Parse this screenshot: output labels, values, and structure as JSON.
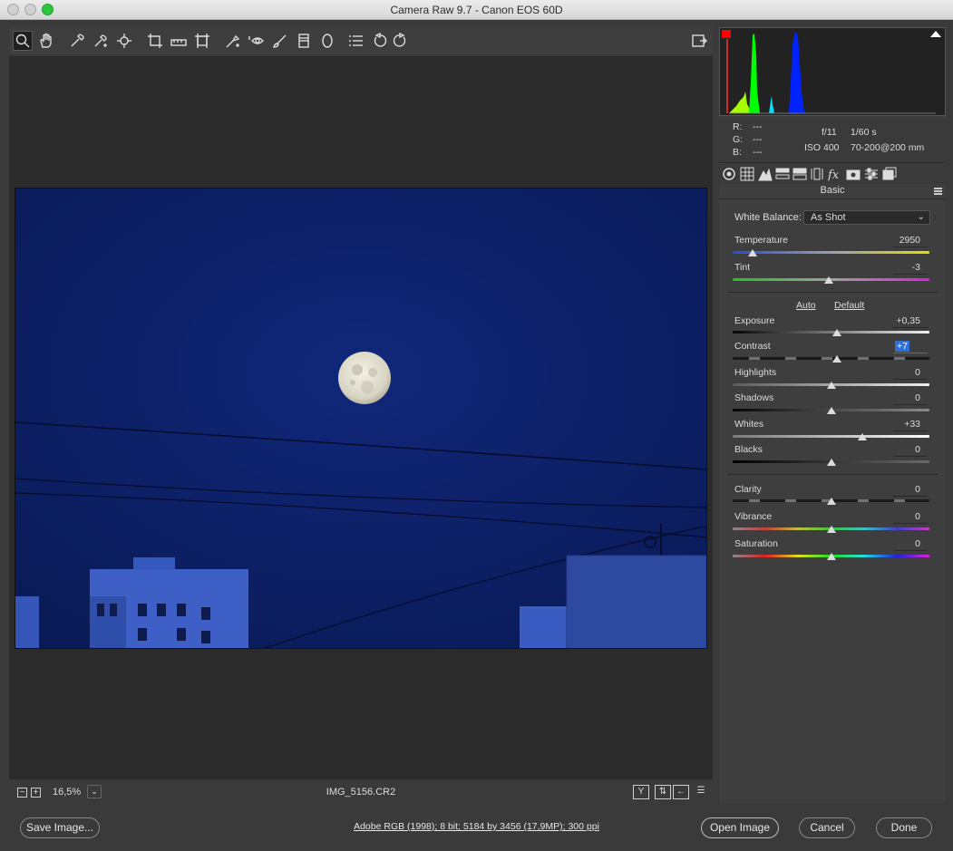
{
  "window": {
    "title": "Camera Raw 9.7  -  Canon EOS 60D"
  },
  "toolbar": {
    "tools": [
      "zoom-icon",
      "hand-icon",
      "white-balance-icon",
      "color-sampler-icon",
      "targeted-adjustment-icon",
      "crop-icon",
      "straighten-icon",
      "transform-icon",
      "spot-removal-icon",
      "red-eye-icon",
      "adjustment-brush-icon",
      "graduated-filter-icon",
      "radial-filter-icon",
      "preferences-icon",
      "rotate-left-icon",
      "rotate-right-icon"
    ],
    "fullscreen_icon": "fullscreen-icon"
  },
  "exif": {
    "r_label": "R:",
    "r_val": "---",
    "g_label": "G:",
    "g_val": "---",
    "b_label": "B:",
    "b_val": "---",
    "aperture": "f/11",
    "shutter": "1/60 s",
    "iso": "ISO 400",
    "lens": "70-200@200 mm"
  },
  "panel": {
    "tabs": [
      "basic-icon",
      "tone-curve-icon",
      "detail-icon",
      "hsl-icon",
      "split-toning-icon",
      "lens-corrections-icon",
      "effects-icon",
      "camera-calibration-icon",
      "presets-icon",
      "snapshots-icon"
    ],
    "title": "Basic",
    "white_balance_label": "White Balance:",
    "white_balance_value": "As Shot",
    "auto_label": "Auto",
    "default_label": "Default",
    "controls": {
      "temperature": {
        "label": "Temperature",
        "value": "2950",
        "position": 0.1
      },
      "tint": {
        "label": "Tint",
        "value": "-3",
        "position": 0.49
      },
      "exposure": {
        "label": "Exposure",
        "value": "+0,35",
        "position": 0.53
      },
      "contrast": {
        "label": "Contrast",
        "value": "+7",
        "position": 0.53
      },
      "highlights": {
        "label": "Highlights",
        "value": "0",
        "position": 0.5
      },
      "shadows": {
        "label": "Shadows",
        "value": "0",
        "position": 0.5
      },
      "whites": {
        "label": "Whites",
        "value": "+33",
        "position": 0.66
      },
      "blacks": {
        "label": "Blacks",
        "value": "0",
        "position": 0.5
      },
      "clarity": {
        "label": "Clarity",
        "value": "0",
        "position": 0.5
      },
      "vibrance": {
        "label": "Vibrance",
        "value": "0",
        "position": 0.5
      },
      "saturation": {
        "label": "Saturation",
        "value": "0",
        "position": 0.5
      }
    }
  },
  "status": {
    "zoom_out": "−",
    "zoom_in": "+",
    "zoom": "16,5%",
    "zoom_dropdown": "⌄",
    "filename": "IMG_5156.CR2",
    "before_after_label": "Y"
  },
  "footer": {
    "save_label": "Save Image...",
    "workflow": "Adobe RGB (1998); 8 bit; 5184 by 3456 (17,9MP); 300 ppi",
    "open_label": "Open Image",
    "cancel_label": "Cancel",
    "done_label": "Done"
  },
  "colors": {
    "photo_bg": "#0b1f63",
    "accent": "#2f6fd6",
    "clip_warning": "#ff0000"
  }
}
